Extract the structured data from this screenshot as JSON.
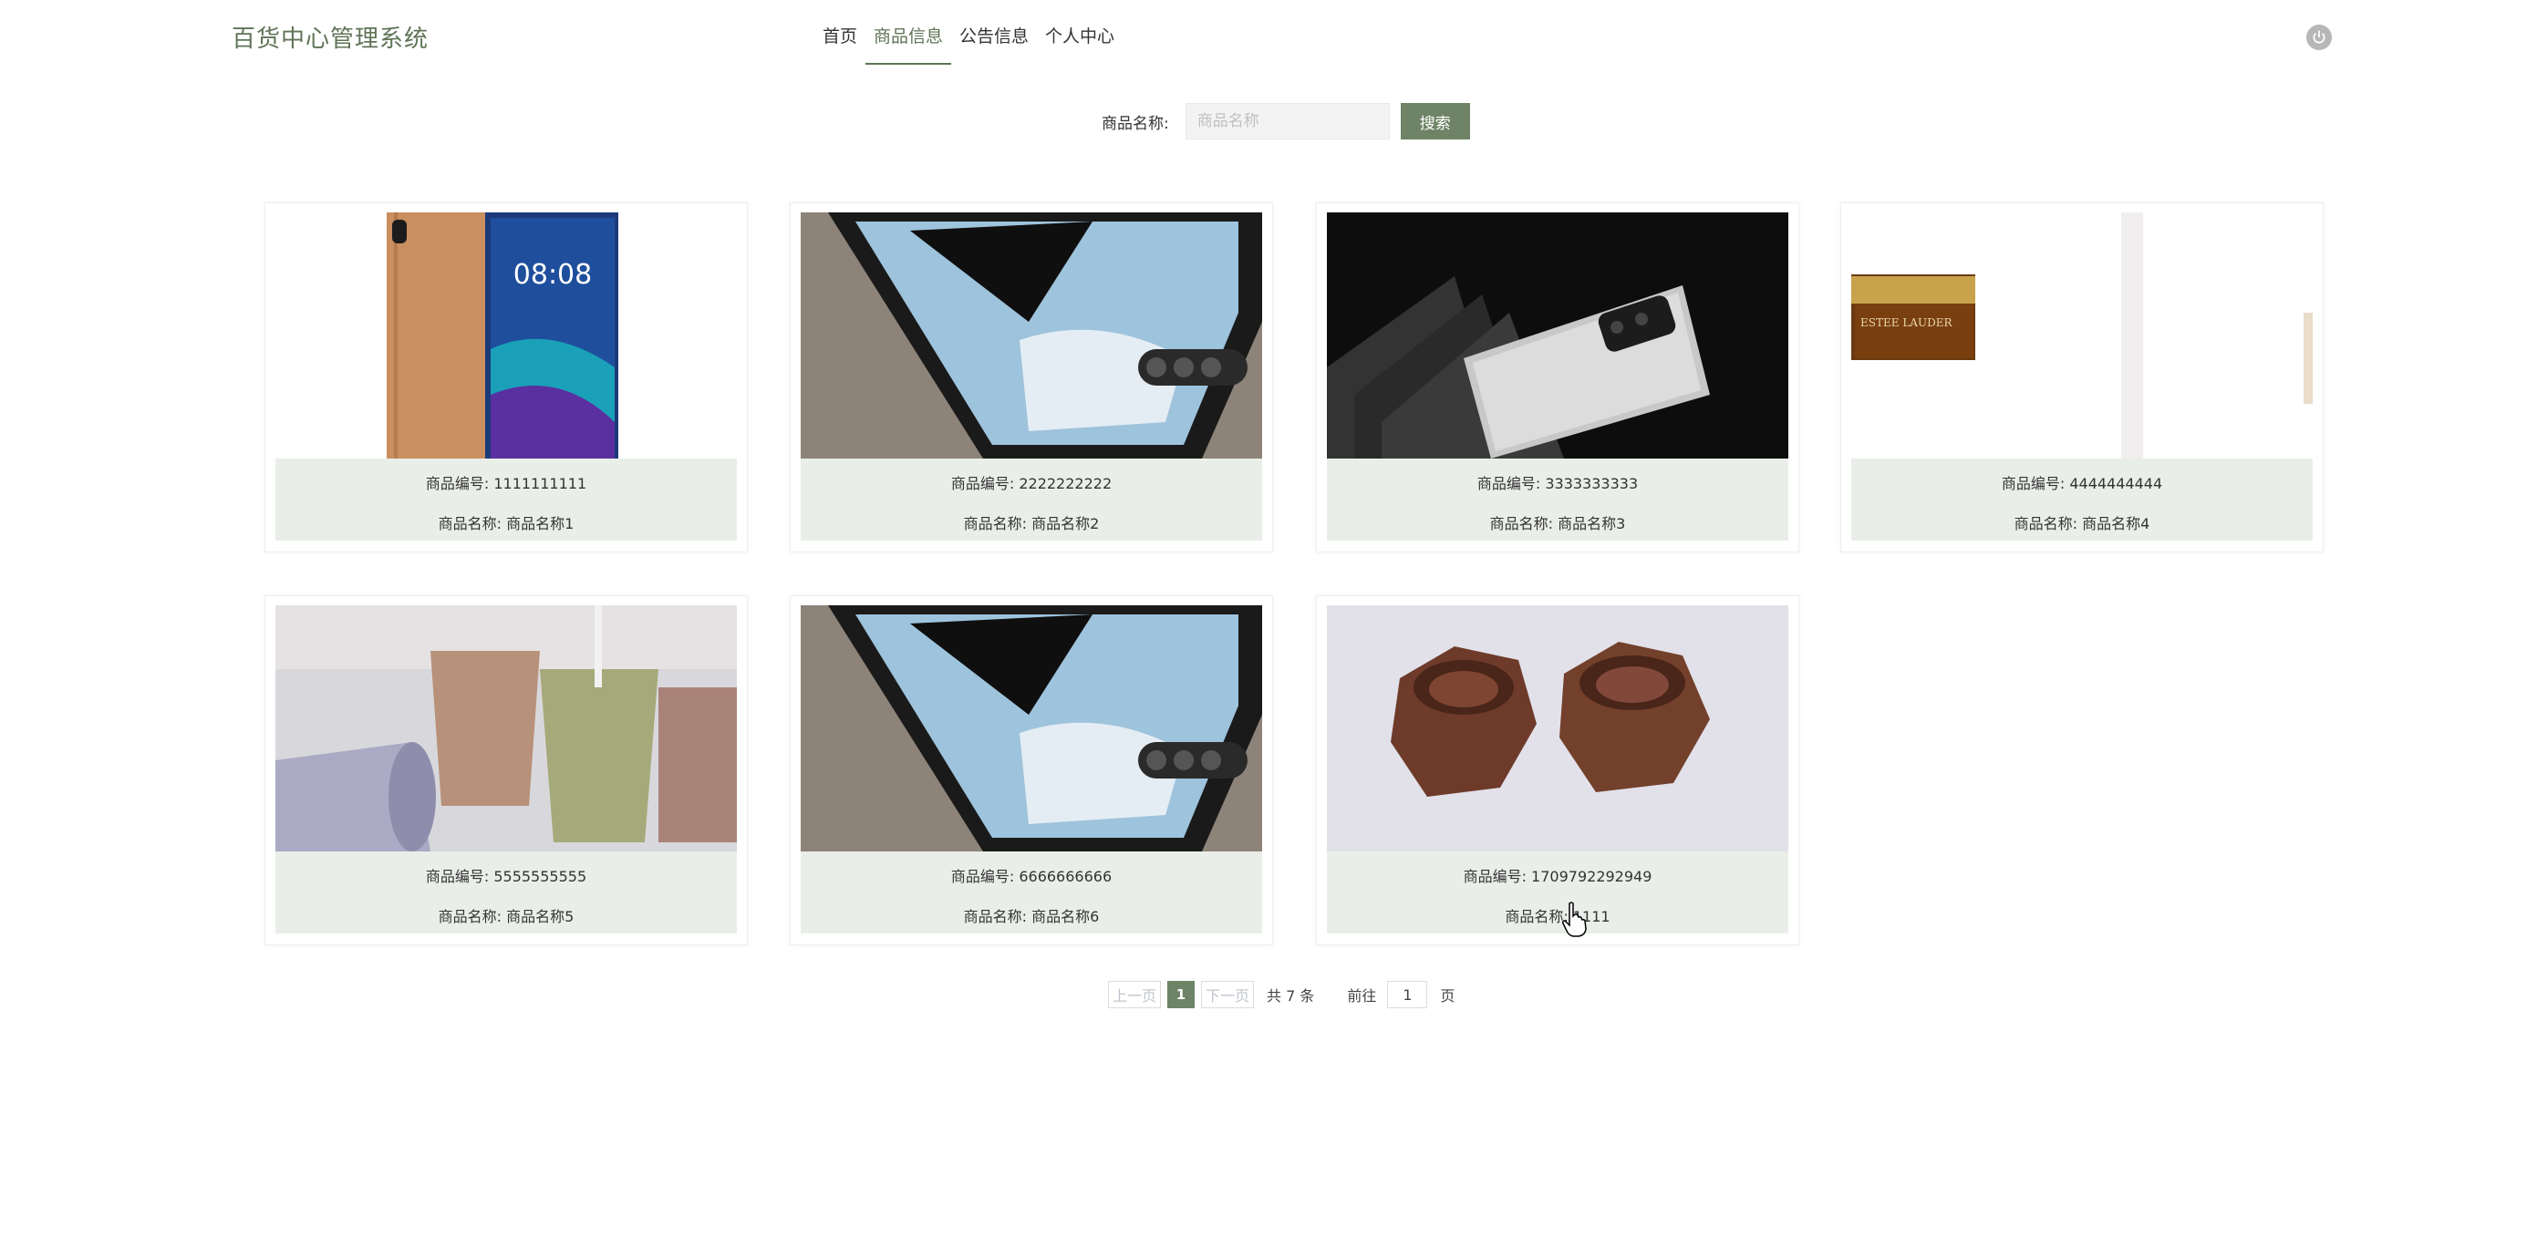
{
  "header": {
    "brand": "百货中心管理系统",
    "nav": [
      "首页",
      "商品信息",
      "公告信息",
      "个人中心"
    ],
    "active_nav": "商品信息"
  },
  "search": {
    "label": "商品名称:",
    "placeholder": "商品名称",
    "button": "搜索"
  },
  "products": [
    {
      "line1": "商品编号: 1111111111",
      "line2": "商品名称: 商品名称1",
      "image": "phone-gold-back"
    },
    {
      "line1": "商品编号: 2222222222",
      "line2": "商品名称: 商品名称2",
      "image": "phone-black-on-fabric"
    },
    {
      "line1": "商品编号: 3333333333",
      "line2": "商品名称: 商品名称3",
      "image": "phone-silver-dark"
    },
    {
      "line1": "商品编号: 4444444444",
      "line2": "商品名称: 商品名称4",
      "image": "cosmetic-jar"
    },
    {
      "line1": "商品编号: 5555555555",
      "line2": "商品名称: 商品名称5",
      "image": "cups"
    },
    {
      "line1": "商品编号: 6666666666",
      "line2": "商品名称: 商品名称6",
      "image": "phone-black-on-fabric"
    },
    {
      "line1": "商品编号: 1709792292949",
      "line2": "商品名称: 1111",
      "image": "hex-nuts"
    }
  ],
  "pagination": {
    "prev": "上一页",
    "current": "1",
    "next": "下一页",
    "total": "共 7 条",
    "goto": "前往",
    "goto_value": "1",
    "unit": "页"
  },
  "colors": {
    "accent": "#6f8466",
    "info_bg": "#eaeee9"
  }
}
